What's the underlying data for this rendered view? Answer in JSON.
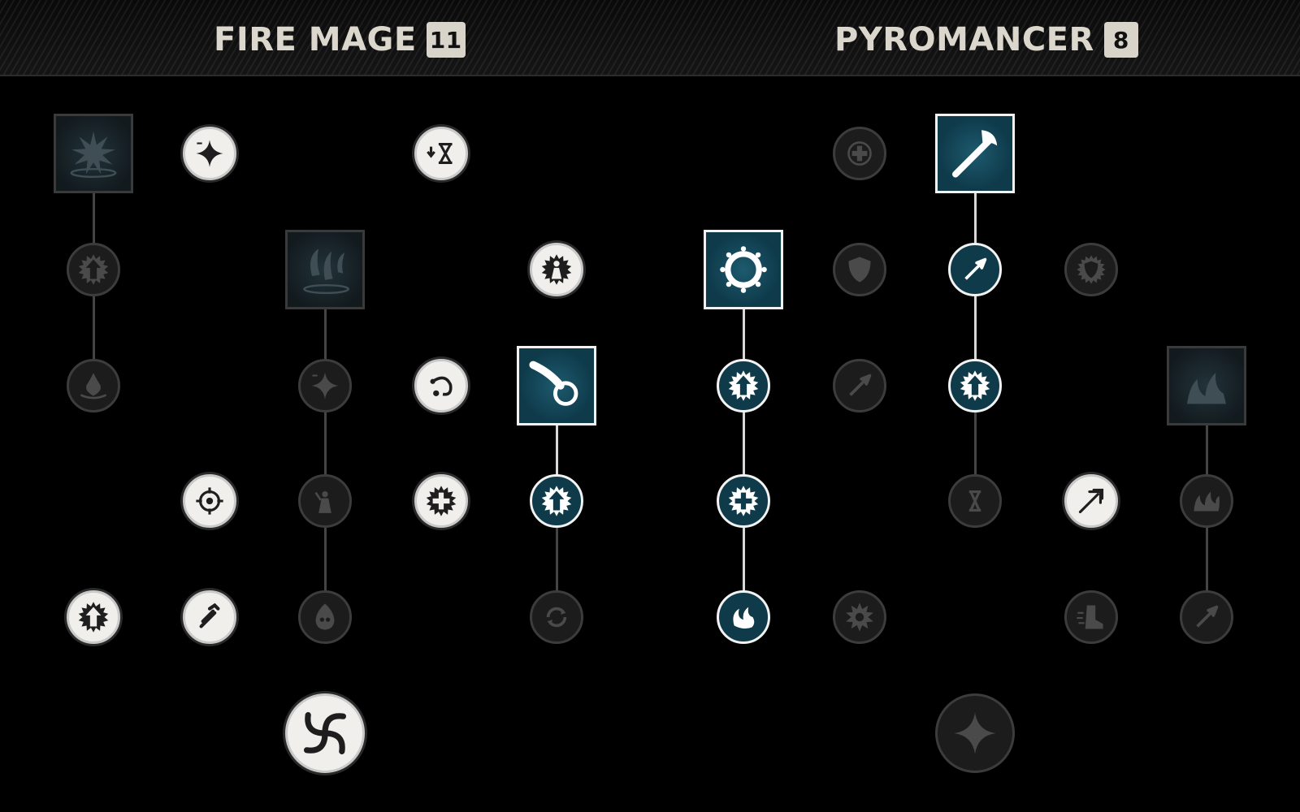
{
  "colors": {
    "active_fill": "#0e3a4a",
    "active_border": "#f2f2f2",
    "white_fill": "#f0efec",
    "dim_fill": "#1c1c1c",
    "dim_border": "#3c3c3c",
    "dim_icon": "#4a4a4a",
    "connector_active": "#d8d8d8",
    "connector_dim": "#444444"
  },
  "trees": [
    {
      "name": "FIRE MAGE",
      "points": "11"
    },
    {
      "name": "PYROMANCER",
      "points": "8"
    }
  ],
  "nodes": [
    {
      "id": "fm-explosion",
      "shape": "square",
      "state": "dim",
      "icon": "explosion-icon"
    },
    {
      "id": "fm-star-minus",
      "shape": "circle",
      "state": "white",
      "icon": "star-minus-icon"
    },
    {
      "id": "fm-hourglass-down",
      "shape": "circle",
      "state": "white",
      "icon": "hourglass-down-icon"
    },
    {
      "id": "fm-arrow-up-1",
      "shape": "circle",
      "state": "dim",
      "icon": "arrow-up-icon"
    },
    {
      "id": "fm-meteors",
      "shape": "square",
      "state": "dim",
      "icon": "meteors-icon"
    },
    {
      "id": "fm-figure",
      "shape": "circle",
      "state": "white",
      "icon": "figure-aura-icon"
    },
    {
      "id": "fm-flame-burst",
      "shape": "circle",
      "state": "dim",
      "icon": "flame-burst-icon"
    },
    {
      "id": "fm-star-minus-2",
      "shape": "circle",
      "state": "dim",
      "icon": "star-minus-icon"
    },
    {
      "id": "fm-bounce",
      "shape": "circle",
      "state": "white",
      "icon": "bounce-icon"
    },
    {
      "id": "fm-fireball",
      "shape": "square",
      "state": "active",
      "icon": "fireball-icon"
    },
    {
      "id": "fm-target",
      "shape": "circle",
      "state": "white",
      "icon": "target-icon"
    },
    {
      "id": "fm-figure-glow",
      "shape": "circle",
      "state": "dim",
      "icon": "figure-glow-icon"
    },
    {
      "id": "fm-cross-burst",
      "shape": "circle",
      "state": "white",
      "icon": "cross-burst-icon"
    },
    {
      "id": "fm-arrow-up-2",
      "shape": "circle",
      "state": "active",
      "icon": "arrow-up-icon"
    },
    {
      "id": "fm-arrow-up-3",
      "shape": "circle",
      "state": "white",
      "icon": "arrow-up-icon"
    },
    {
      "id": "fm-dash",
      "shape": "circle",
      "state": "white",
      "icon": "dash-icon"
    },
    {
      "id": "fm-skull",
      "shape": "circle",
      "state": "dim",
      "icon": "skull-fire-icon"
    },
    {
      "id": "fm-cycle",
      "shape": "circle",
      "state": "dim",
      "icon": "cycle-icon"
    },
    {
      "id": "fm-vortex",
      "shape": "big",
      "state": "white",
      "icon": "vortex-icon"
    },
    {
      "id": "py-heal-cross",
      "shape": "circle",
      "state": "dim",
      "icon": "heal-cross-icon"
    },
    {
      "id": "py-staff",
      "shape": "square",
      "state": "active",
      "icon": "staff-icon"
    },
    {
      "id": "py-ring",
      "shape": "square",
      "state": "active",
      "icon": "fire-ring-icon"
    },
    {
      "id": "py-shield",
      "shape": "circle",
      "state": "dim",
      "icon": "shield-icon"
    },
    {
      "id": "py-arrow-diag",
      "shape": "circle",
      "state": "active",
      "icon": "arrow-diagonal-icon"
    },
    {
      "id": "py-sun-shield",
      "shape": "circle",
      "state": "dim",
      "icon": "sun-shield-icon"
    },
    {
      "id": "py-arrow-up-a",
      "shape": "circle",
      "state": "active",
      "icon": "arrow-up-icon"
    },
    {
      "id": "py-arrow-diag-dim",
      "shape": "circle",
      "state": "dim",
      "icon": "arrow-diagonal-icon"
    },
    {
      "id": "py-arrow-up-b",
      "shape": "circle",
      "state": "active",
      "icon": "arrow-up-icon"
    },
    {
      "id": "py-fire-feet",
      "shape": "square",
      "state": "dim",
      "icon": "fire-feet-icon"
    },
    {
      "id": "py-cross-burst",
      "shape": "circle",
      "state": "active",
      "icon": "cross-burst-icon"
    },
    {
      "id": "py-hourglass",
      "shape": "circle",
      "state": "dim",
      "icon": "hourglass-icon"
    },
    {
      "id": "py-trident",
      "shape": "circle",
      "state": "white",
      "icon": "trident-icon"
    },
    {
      "id": "py-flames",
      "shape": "circle",
      "state": "dim",
      "icon": "flames-icon"
    },
    {
      "id": "py-fire-swirl",
      "shape": "circle",
      "state": "active",
      "icon": "fire-swirl-icon"
    },
    {
      "id": "py-burst",
      "shape": "circle",
      "state": "dim",
      "icon": "burst-icon"
    },
    {
      "id": "py-boot",
      "shape": "circle",
      "state": "dim",
      "icon": "boot-icon"
    },
    {
      "id": "py-arrow-diag-2",
      "shape": "circle",
      "state": "dim",
      "icon": "arrow-diagonal-icon"
    },
    {
      "id": "py-star-big",
      "shape": "big",
      "state": "dim",
      "icon": "star-icon"
    }
  ],
  "links": [
    {
      "from": "fm-explosion",
      "to": "fm-arrow-up-1",
      "state": "dim"
    },
    {
      "from": "fm-arrow-up-1",
      "to": "fm-flame-burst",
      "state": "dim"
    },
    {
      "from": "fm-meteors",
      "to": "fm-star-minus-2",
      "state": "dim"
    },
    {
      "from": "fm-star-minus-2",
      "to": "fm-figure-glow",
      "state": "dim"
    },
    {
      "from": "fm-figure-glow",
      "to": "fm-skull",
      "state": "dim"
    },
    {
      "from": "fm-fireball",
      "to": "fm-arrow-up-2",
      "state": "active"
    },
    {
      "from": "fm-arrow-up-2",
      "to": "fm-cycle",
      "state": "dim"
    },
    {
      "from": "py-staff",
      "to": "py-arrow-diag",
      "state": "active"
    },
    {
      "from": "py-arrow-diag",
      "to": "py-arrow-up-b",
      "state": "active"
    },
    {
      "from": "py-arrow-up-b",
      "to": "py-hourglass",
      "state": "dim"
    },
    {
      "from": "py-ring",
      "to": "py-arrow-up-a",
      "state": "active"
    },
    {
      "from": "py-arrow-up-a",
      "to": "py-cross-burst",
      "state": "active"
    },
    {
      "from": "py-cross-burst",
      "to": "py-fire-swirl",
      "state": "active"
    },
    {
      "from": "py-fire-feet",
      "to": "py-flames",
      "state": "dim"
    },
    {
      "from": "py-flames",
      "to": "py-arrow-diag-2",
      "state": "dim"
    }
  ]
}
